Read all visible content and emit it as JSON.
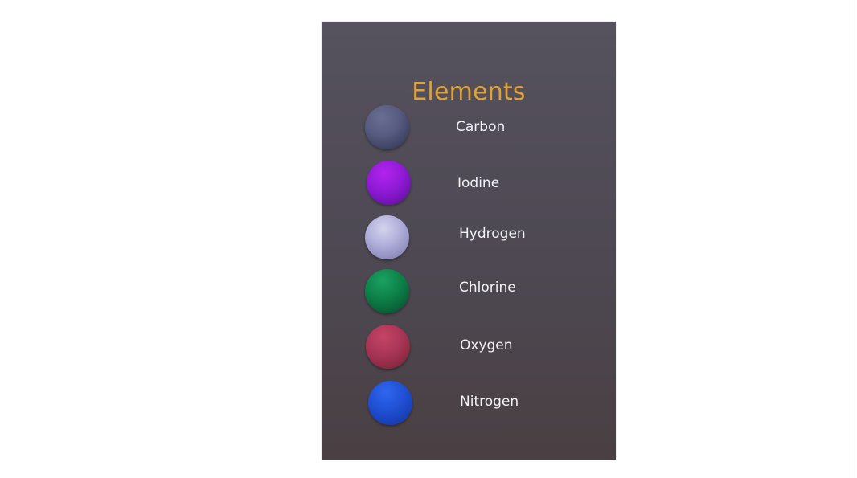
{
  "panel": {
    "title": "Elements",
    "title_color": "#e0a234",
    "background_top": "#56525e",
    "background_bottom": "#4a4043"
  },
  "elements": [
    {
      "label": "Carbon",
      "icon": "carbon-sphere-icon",
      "color": "#555a7e"
    },
    {
      "label": "Iodine",
      "icon": "iodine-sphere-icon",
      "color": "#8f1ad6"
    },
    {
      "label": "Hydrogen",
      "icon": "hydrogen-sphere-icon",
      "color": "#b2b1dc"
    },
    {
      "label": "Chlorine",
      "icon": "chlorine-sphere-icon",
      "color": "#0d8048"
    },
    {
      "label": "Oxygen",
      "icon": "oxygen-sphere-icon",
      "color": "#a83556"
    },
    {
      "label": "Nitrogen",
      "icon": "nitrogen-sphere-icon",
      "color": "#1f4fd4"
    }
  ]
}
